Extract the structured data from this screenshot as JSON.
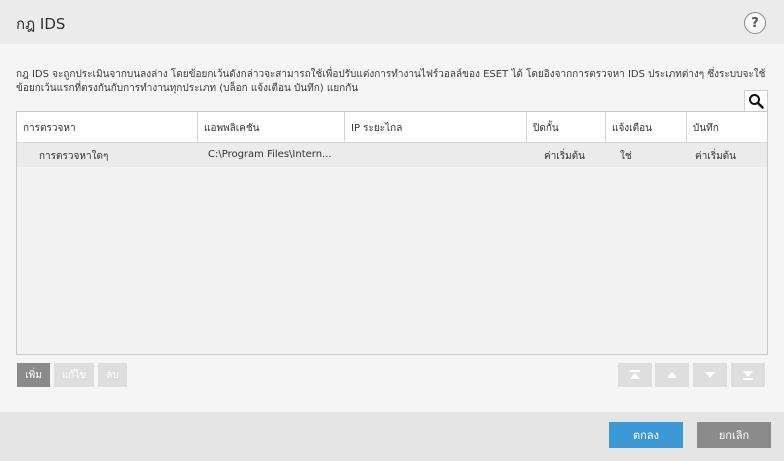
{
  "window": {
    "title": "กฎ IDS",
    "help_label": "?"
  },
  "description": "กฎ IDS จะถูกประเมินจากบนลงล่าง โดยข้อยกเว้นดังกล่าวจะสามารถใช้เพื่อปรับแต่งการทำงานไฟร์วอลล์ของ ESET ได้ โดยอิงจากการตรวจหา IDS ประเภทต่างๆ ซึ่งระบบจะใช้ข้อยกเว้นแรกที่ตรงกันกับการทำงานทุกประเภท (บล็อก แจ้งเตือน บันทึก) แยกกัน",
  "table": {
    "columns": [
      "การตรวจหา",
      "แอพพลิเคชัน",
      "IP ระยะไกล",
      "ปิดกั้น",
      "แจ้งเตือน",
      "บันทึก"
    ],
    "rows": [
      {
        "detection": "การตรวจหาใดๆ",
        "application": "C:\\Program Files\\Intern...",
        "remote_ip": "",
        "block": "ค่าเริ่มต้น",
        "notify": "ใช่",
        "log": "ค่าเริ่มต้น"
      }
    ]
  },
  "toolbar": {
    "add_label": "เพิ่ม",
    "edit_label": "แก้ไข",
    "delete_label": "ลบ"
  },
  "footer": {
    "ok_label": "ตกลง",
    "cancel_label": "ยกเลิก"
  },
  "colors": {
    "accent": "#3c99d6",
    "secondary_button": "#8b8b8b"
  }
}
